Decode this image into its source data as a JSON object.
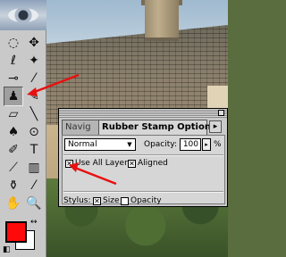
{
  "toolbox": {
    "tools": [
      {
        "name": "marquee-tool",
        "glyph": "◌"
      },
      {
        "name": "move-tool",
        "glyph": "✥"
      },
      {
        "name": "lasso-tool",
        "glyph": "ℓ"
      },
      {
        "name": "magic-wand-tool",
        "glyph": "✦"
      },
      {
        "name": "airbrush-tool",
        "glyph": "⊸"
      },
      {
        "name": "paintbrush-tool",
        "glyph": "⁄"
      },
      {
        "name": "rubber-stamp-tool",
        "glyph": "♟"
      },
      {
        "name": "smudge-tool",
        "glyph": "✎"
      },
      {
        "name": "eraser-tool",
        "glyph": "▱"
      },
      {
        "name": "line-tool",
        "glyph": "╲"
      },
      {
        "name": "pen-tool",
        "glyph": "♠"
      },
      {
        "name": "dodge-tool",
        "glyph": "⊙"
      },
      {
        "name": "pencil-tool",
        "glyph": "✐"
      },
      {
        "name": "type-tool",
        "glyph": "T"
      },
      {
        "name": "measure-tool",
        "glyph": "⟋"
      },
      {
        "name": "gradient-tool",
        "glyph": "▥"
      },
      {
        "name": "paint-bucket-tool",
        "glyph": "⚱"
      },
      {
        "name": "eyedropper-tool",
        "glyph": "⁄"
      },
      {
        "name": "hand-tool",
        "glyph": "✋"
      },
      {
        "name": "zoom-tool",
        "glyph": "🔍"
      }
    ],
    "selected_tool": "rubber-stamp-tool",
    "foreground_color": "#ff0a0a",
    "background_color": "#ffffff"
  },
  "palette": {
    "inactive_tab": "Navig",
    "active_tab": "Rubber Stamp Options",
    "close_glyph": "×",
    "menu_glyph": "▸",
    "mode_value": "Normal",
    "opacity_label": "Opacity:",
    "opacity_value": "100",
    "percent": "%",
    "use_all_layers_label": "Use All Layers",
    "aligned_label": "Aligned",
    "stylus_label": "Stylus:",
    "size_label": "Size",
    "opacity_stylus_label": "Opacity",
    "check_glyph": "✕"
  },
  "annotations": {
    "arrow_color": "#e81010"
  }
}
